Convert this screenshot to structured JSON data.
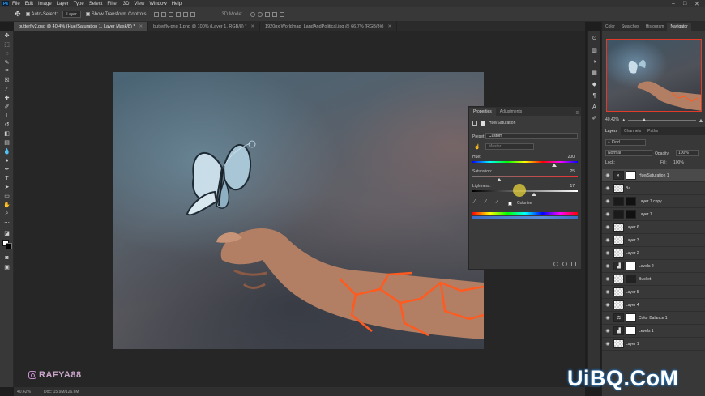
{
  "menubar": {
    "app_icon": "Ps",
    "items": [
      "File",
      "Edit",
      "Image",
      "Layer",
      "Type",
      "Select",
      "Filter",
      "3D",
      "View",
      "Window",
      "Help"
    ],
    "window_controls": [
      "–",
      "□",
      "✕"
    ]
  },
  "options": {
    "auto_select_label": "Auto-Select:",
    "auto_select_target": "Layer",
    "show_transform_label": "Show Transform Controls",
    "mode_3d_label": "3D Mode:"
  },
  "tabs": [
    {
      "label": "butterfly2.psd @ 40.4% (Hue/Saturation 1, Layer Mask/8) *",
      "active": true
    },
    {
      "label": "butterfly-png 1.png @ 100% (Layer 1, RGB/8) *",
      "active": false
    },
    {
      "label": "1920px Worldmap_LandAndPolitical.jpg @ 66.7% (RGB/8#)",
      "active": false
    }
  ],
  "properties": {
    "tabs": [
      "Properties",
      "Adjustments"
    ],
    "adjustment_name": "Hue/Saturation",
    "preset_label": "Preset:",
    "preset_value": "Custom",
    "channel_value": "Master",
    "hue_label": "Hue:",
    "hue_value": "200",
    "saturation_label": "Saturation:",
    "saturation_value": "25",
    "lightness_label": "Lightness:",
    "lightness_value": "17",
    "colorize_label": "Colorize",
    "hue_position": 0.775,
    "saturation_position": 0.25,
    "lightness_position": 0.585
  },
  "navigator": {
    "tabs": [
      "Color",
      "Swatches",
      "Histogram",
      "Navigator"
    ],
    "zoom": "40.42%"
  },
  "layers_panel": {
    "tabs": [
      "Layers",
      "Channels",
      "Paths"
    ],
    "filter_kind": "Kind",
    "blend_mode": "Normal",
    "opacity_label": "Opacity:",
    "opacity_value": "100%",
    "lock_label": "Lock:",
    "fill_label": "Fill:",
    "fill_value": "100%",
    "layers": [
      {
        "name": "Hue/Saturation 1",
        "thumb": "adj",
        "mask": true,
        "selected": true
      },
      {
        "name": "Ba...",
        "thumb": "check",
        "mask": false,
        "selected": false
      },
      {
        "name": "Layer 7 copy",
        "thumb": "dark",
        "mask": true,
        "selected": false
      },
      {
        "name": "Layer 7",
        "thumb": "dark",
        "mask": true,
        "selected": false
      },
      {
        "name": "Layer 6",
        "thumb": "check",
        "mask": false,
        "selected": false
      },
      {
        "name": "Layer 3",
        "thumb": "check",
        "mask": false,
        "selected": false
      },
      {
        "name": "Layer 2",
        "thumb": "check",
        "mask": false,
        "selected": false
      },
      {
        "name": "Levels 2",
        "thumb": "adj",
        "mask": true,
        "selected": false
      },
      {
        "name": "Bucket",
        "thumb": "check",
        "mask": true,
        "selected": false
      },
      {
        "name": "Layer 5",
        "thumb": "check",
        "mask": false,
        "selected": false
      },
      {
        "name": "Layer 4",
        "thumb": "check",
        "mask": false,
        "selected": false
      },
      {
        "name": "Color Balance 1",
        "thumb": "adj",
        "mask": true,
        "selected": false
      },
      {
        "name": "Levels 1",
        "thumb": "adj",
        "mask": true,
        "selected": false
      },
      {
        "name": "Layer 1",
        "thumb": "check",
        "mask": false,
        "selected": false
      }
    ]
  },
  "status": {
    "zoom": "40.42%",
    "doc": "Doc: 15.9M/126.6M"
  },
  "watermark": {
    "handle": "RAFYA88"
  },
  "site_logo": "UiBQ.CoM",
  "colors": {
    "accent": "#e23b2a",
    "selection_cursor": "#e6d23c"
  }
}
